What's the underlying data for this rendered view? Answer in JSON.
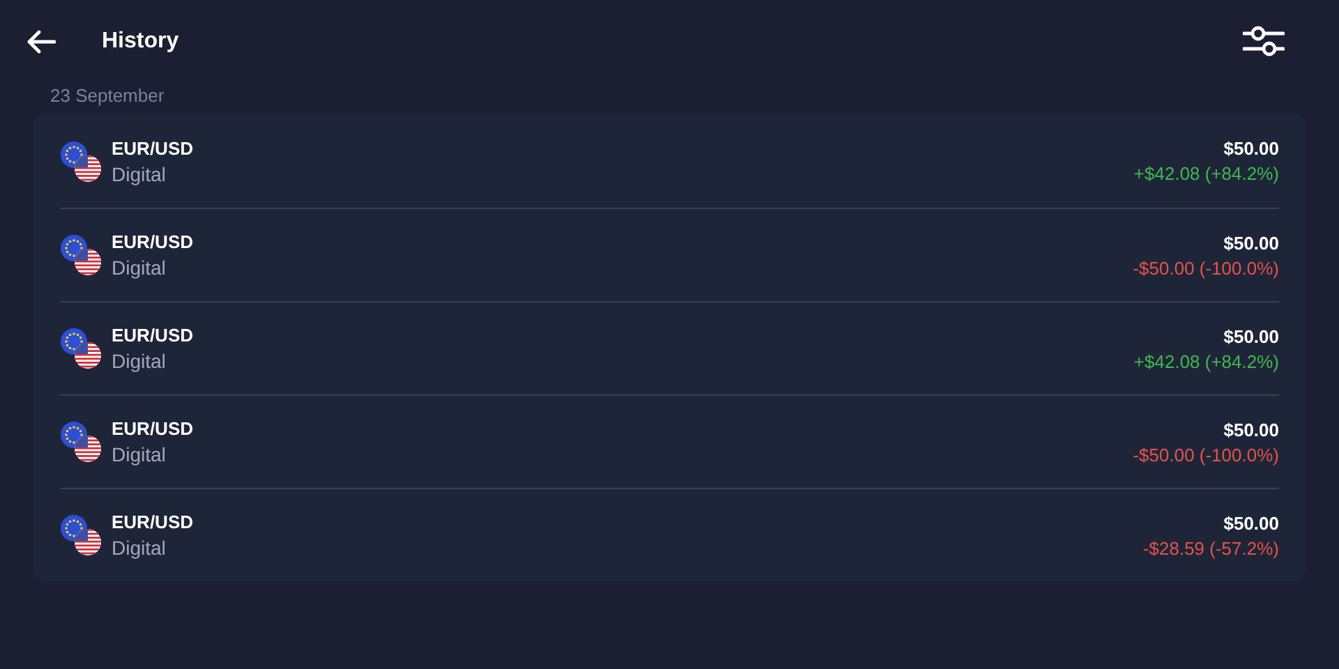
{
  "header": {
    "title": "History"
  },
  "date": "23 September",
  "trades": [
    {
      "pair": "EUR/USD",
      "type": "Digital",
      "amount": "$50.00",
      "result": "+$42.08 (+84.2%)",
      "kind": "win"
    },
    {
      "pair": "EUR/USD",
      "type": "Digital",
      "amount": "$50.00",
      "result": "-$50.00 (-100.0%)",
      "kind": "loss"
    },
    {
      "pair": "EUR/USD",
      "type": "Digital",
      "amount": "$50.00",
      "result": "+$42.08 (+84.2%)",
      "kind": "win"
    },
    {
      "pair": "EUR/USD",
      "type": "Digital",
      "amount": "$50.00",
      "result": "-$50.00 (-100.0%)",
      "kind": "loss"
    },
    {
      "pair": "EUR/USD",
      "type": "Digital",
      "amount": "$50.00",
      "result": "-$28.59 (-57.2%)",
      "kind": "loss"
    }
  ]
}
